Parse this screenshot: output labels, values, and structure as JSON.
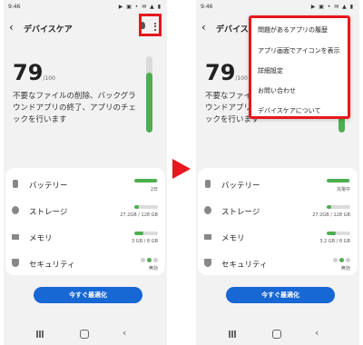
{
  "colors": {
    "accent": "#4caf50",
    "button": "#1767d5",
    "highlight": "#e8161d"
  },
  "left": {
    "status": {
      "time": "9:46",
      "system_icons": "▶ ▣ • ✉ ▲ ▮"
    },
    "header": {
      "title": "デバイスケア"
    },
    "score": {
      "value": "79",
      "max": "/100",
      "level": 0.79
    },
    "description": "不要なファイルの削除、バックグラウンドアプリの終了、アプリのチェックを行います",
    "items": [
      {
        "label": "バッテリー",
        "value": "2日",
        "level": 0.95
      },
      {
        "label": "ストレージ",
        "value": "27.2GB / 128 GB",
        "level": 0.21
      },
      {
        "label": "メモリ",
        "value": "3 GB / 8 GB",
        "level": 0.38
      },
      {
        "label": "セキュリティ",
        "value": "無効"
      }
    ],
    "optimize_button": "今すぐ最適化"
  },
  "right": {
    "status": {
      "time": "9:46",
      "system_icons": "▶ ▣ • ✉ ▲ ▮"
    },
    "header": {
      "title": "デバイスケア"
    },
    "score": {
      "value": "79",
      "max": "/100",
      "level": 0.79
    },
    "description": "不要なファイルの削除、バックグラウンドアプリの終了、アプリのチェックを行います",
    "items": [
      {
        "label": "バッテリー",
        "value": "充電中",
        "level": 0.95
      },
      {
        "label": "ストレージ",
        "value": "27.2GB / 128 GB",
        "level": 0.21
      },
      {
        "label": "メモリ",
        "value": "3.2 GB / 8 GB",
        "level": 0.4
      },
      {
        "label": "セキュリティ",
        "value": "無効"
      }
    ],
    "optimize_button": "今すぐ最適化",
    "menu": [
      "問題があるアプリの履歴",
      "アプリ画面でアイコンを表示",
      "詳細設定",
      "お問い合わせ",
      "デバイスケアについて"
    ]
  }
}
